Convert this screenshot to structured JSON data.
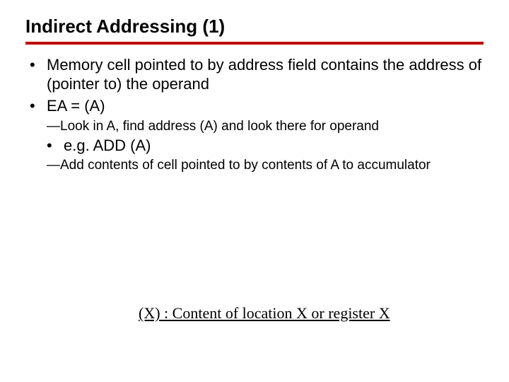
{
  "title": "Indirect Addressing (1)",
  "bullets": {
    "b1": "Memory cell pointed to by address field contains the address of (pointer to) the operand",
    "b2": "EA = (A)",
    "b2_sub1": "Look in A, find address (A) and look there for operand",
    "b3": "e.g. ADD (A)",
    "b3_sub1": "Add contents of cell pointed to by contents of A to accumulator"
  },
  "footnote": "(X) : Content of location X or register X"
}
